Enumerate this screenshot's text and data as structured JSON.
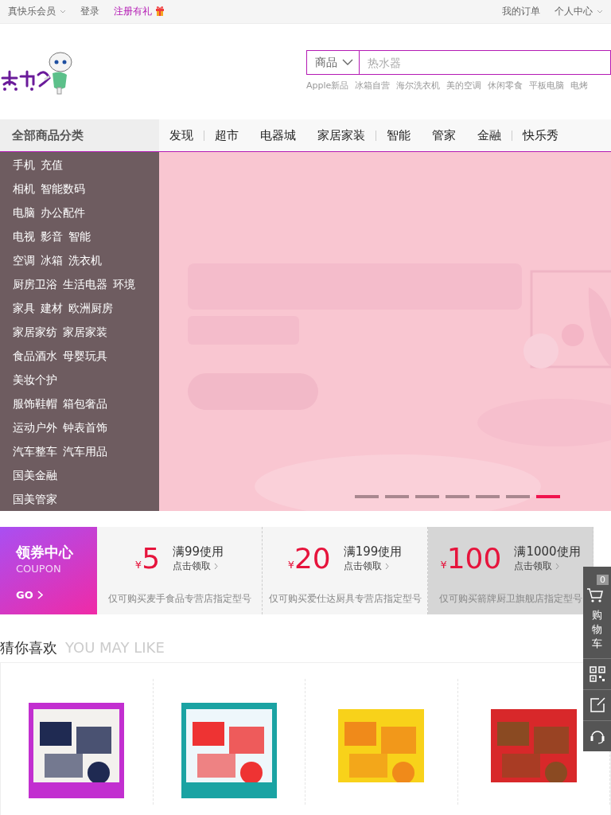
{
  "top_bar": {
    "left": [
      {
        "label": "真快乐会员",
        "dropdown": true,
        "kind": "plain"
      },
      {
        "label": "登录",
        "dropdown": false,
        "kind": "plain"
      },
      {
        "label": "注册有礼",
        "dropdown": false,
        "kind": "promo"
      }
    ],
    "right": [
      {
        "label": "我的订单",
        "dropdown": false
      },
      {
        "label": "个人中心",
        "dropdown": true
      }
    ]
  },
  "search": {
    "category": "商品",
    "placeholder": "热水器",
    "hot_words": [
      "Apple新品",
      "冰箱自营",
      "海尔洗衣机",
      "美的空调",
      "休闲零食",
      "平板电脑",
      "电烤"
    ]
  },
  "nav": {
    "category_title": "全部商品分类",
    "links": [
      {
        "label": "发现",
        "divider": true
      },
      {
        "label": "超市",
        "divider": false
      },
      {
        "label": "电器城",
        "divider": false
      },
      {
        "label": "家居家装",
        "divider": true
      },
      {
        "label": "智能",
        "divider": false
      },
      {
        "label": "管家",
        "divider": false
      },
      {
        "label": "金融",
        "divider": true
      },
      {
        "label": "快乐秀",
        "divider": false
      }
    ]
  },
  "categories": [
    [
      "手机",
      "充值"
    ],
    [
      "相机",
      "智能数码"
    ],
    [
      "电脑",
      "办公配件"
    ],
    [
      "电视",
      "影音",
      "智能"
    ],
    [
      "空调",
      "冰箱",
      "洗衣机"
    ],
    [
      "厨房卫浴",
      "生活电器",
      "环境"
    ],
    [
      "家具",
      "建材",
      "欧洲厨房"
    ],
    [
      "家居家纺",
      "家居家装"
    ],
    [
      "食品酒水",
      "母婴玩具"
    ],
    [
      "美妆个护"
    ],
    [
      "服饰鞋帽",
      "箱包奢品"
    ],
    [
      "运动户外",
      "钟表首饰"
    ],
    [
      "汽车整车",
      "汽车用品"
    ],
    [
      "国美金融"
    ],
    [
      "国美管家"
    ]
  ],
  "banner": {
    "kind": "picture",
    "dots": [
      {
        "selected": false
      },
      {
        "selected": false
      },
      {
        "selected": false
      },
      {
        "selected": false
      },
      {
        "selected": false
      },
      {
        "selected": false
      },
      {
        "selected": true
      }
    ]
  },
  "coupon_center": {
    "title": "领券中心",
    "subtitle": "COUPON",
    "go": "GO"
  },
  "coupons": [
    {
      "currency": "¥",
      "amount": "5",
      "condition": "满99使用",
      "action": "点击领取",
      "note": "仅可购买麦手食品专营店指定型号",
      "highlighted": false
    },
    {
      "currency": "¥",
      "amount": "20",
      "condition": "满199使用",
      "action": "点击领取",
      "note": "仅可购买爱仕达厨具专营店指定型号",
      "highlighted": false
    },
    {
      "currency": "¥",
      "amount": "100",
      "condition": "满1000使用",
      "action": "点击领取",
      "note": "仅可购买箭牌厨卫旗舰店指定型号",
      "highlighted": true
    }
  ],
  "recommend": {
    "title": "猜你喜欢",
    "subtitle": "YOU MAY LIKE"
  },
  "side_tools": {
    "cart_count": "0",
    "cart_label": "购物车"
  }
}
